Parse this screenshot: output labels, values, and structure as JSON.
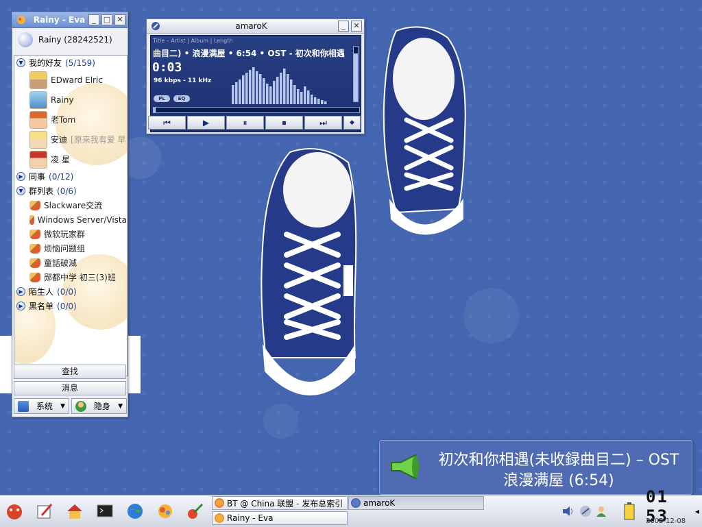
{
  "eva": {
    "title": "Rainy - Eva",
    "user": "Rainy (28242521)",
    "groups": {
      "friends": {
        "label": "我的好友",
        "count": "(5/159)"
      },
      "colleagues": {
        "label": "同事",
        "count": "(0/12)"
      },
      "qun": {
        "label": "群列表",
        "count": "(0/6)"
      },
      "strangers": {
        "label": "陌生人",
        "count": "(0/0)"
      },
      "blacklist": {
        "label": "黑名单",
        "count": "(0/0)"
      }
    },
    "friends": [
      {
        "name": "EDward Elric",
        "note": ""
      },
      {
        "name": "Rainy",
        "note": ""
      },
      {
        "name": "老Tom",
        "note": ""
      },
      {
        "name": "安迪",
        "note": "[原来我有爱 早"
      },
      {
        "name": "凌 星",
        "note": ""
      }
    ],
    "qun_list": [
      "Slackware交流",
      "Windows Server/Vista",
      "微软玩家群",
      "烦恼问题组",
      "童話破滅",
      "郧都中学 初三(3)班"
    ],
    "search_label": "查找",
    "message_label": "消息",
    "system_label": "系统",
    "invisible_label": "隐身"
  },
  "amarok": {
    "title": "amaroK",
    "header": "Title – Artist | Album | Length",
    "track": "曲目二)  •  浪漫满屋  •  6:54  •  OST - 初次和你相遇",
    "time": "0:03",
    "bitrate": "96 kbps - 11 kHz",
    "pl_label": "PL",
    "eq_label": "EQ",
    "volume_fraction": 0.88,
    "progress_fraction": 0.01
  },
  "osd": {
    "line1": "初次和你相遇(未收録曲目二) – OST",
    "line2": "浪漫满屋 (6:54)"
  },
  "taskbar": {
    "tasks": [
      {
        "label": "BT @ China 联盟 - 发布总索引",
        "active": false
      },
      {
        "label": "amaroK",
        "active": true
      },
      {
        "label": "Rainy - Eva",
        "active": false
      }
    ],
    "clock": "01 53",
    "date": "2005-12-08"
  },
  "colors": {
    "desktop": "#4466b0",
    "osd": "#4f6bb3",
    "amarok_display": "#273f82"
  }
}
